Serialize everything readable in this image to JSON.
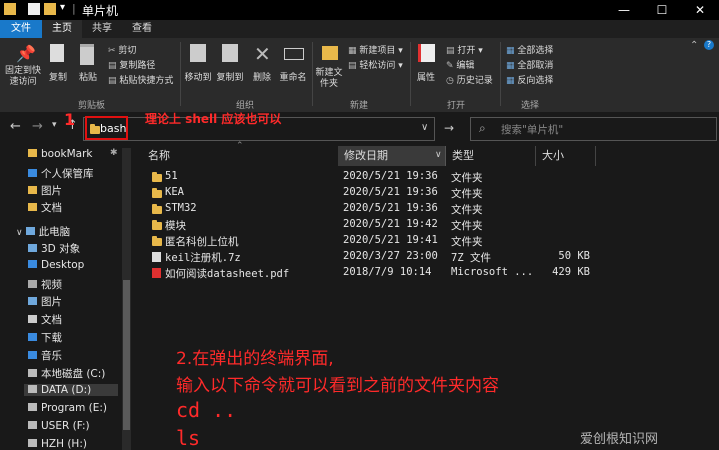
{
  "window": {
    "title": "单片机",
    "min": "—",
    "max": "☐",
    "close": "✕"
  },
  "tabs": [
    "文件",
    "主页",
    "共享",
    "查看"
  ],
  "ribbon": {
    "pin": "固定到快速访问",
    "copy": "复制",
    "paste": "粘贴",
    "cut": "剪切",
    "copy_path": "复制路径",
    "paste_shortcut": "粘贴快捷方式",
    "clipboard_group": "剪贴板",
    "move_to": "移动到",
    "copy_to": "复制到",
    "delete": "删除",
    "rename": "重命名",
    "organize_group": "组织",
    "new_folder": "新建文件夹",
    "new_item": "新建项目",
    "easy_access": "轻松访问",
    "new_group": "新建",
    "properties": "属性",
    "open": "打开",
    "edit": "编辑",
    "history": "历史记录",
    "open_group": "打开",
    "select_all": "全部选择",
    "select_none": "全部取消",
    "invert": "反向选择",
    "select_group": "选择"
  },
  "nav": {
    "address": "bash",
    "search_placeholder": "搜索\"单片机\"",
    "anno_num1": "1",
    "anno_text1": "理论上 shell 应该也可以"
  },
  "sidebar": [
    {
      "label": "bookMark",
      "icon": "folder-icon"
    },
    {
      "label": "个人保管库",
      "icon": "vault-icon"
    },
    {
      "label": "图片",
      "icon": "folder-icon"
    },
    {
      "label": "文档",
      "icon": "folder-icon"
    },
    {
      "label": "此电脑",
      "icon": "pc-icon"
    },
    {
      "label": "3D 对象",
      "icon": "cube-icon"
    },
    {
      "label": "Desktop",
      "icon": "desktop-icon"
    },
    {
      "label": "视频",
      "icon": "video-icon"
    },
    {
      "label": "图片",
      "icon": "picture-icon"
    },
    {
      "label": "文档",
      "icon": "document-icon"
    },
    {
      "label": "下载",
      "icon": "download-icon"
    },
    {
      "label": "音乐",
      "icon": "music-icon"
    },
    {
      "label": "本地磁盘 (C:)",
      "icon": "drive-icon"
    },
    {
      "label": "DATA (D:)",
      "icon": "drive-icon"
    },
    {
      "label": "Program (E:)",
      "icon": "drive-icon"
    },
    {
      "label": "USER (F:)",
      "icon": "drive-icon"
    },
    {
      "label": "HZH (H:)",
      "icon": "drive-icon"
    }
  ],
  "columns": {
    "name": "名称",
    "date": "修改日期",
    "type": "类型",
    "size": "大小"
  },
  "files": [
    {
      "name": "51",
      "date": "2020/5/21 19:36",
      "type": "文件夹",
      "size": "",
      "kind": "folder"
    },
    {
      "name": "KEA",
      "date": "2020/5/21 19:36",
      "type": "文件夹",
      "size": "",
      "kind": "folder"
    },
    {
      "name": "STM32",
      "date": "2020/5/21 19:36",
      "type": "文件夹",
      "size": "",
      "kind": "folder"
    },
    {
      "name": "模块",
      "date": "2020/5/21 19:42",
      "type": "文件夹",
      "size": "",
      "kind": "folder"
    },
    {
      "name": "匿名科创上位机",
      "date": "2020/5/21 19:41",
      "type": "文件夹",
      "size": "",
      "kind": "folder"
    },
    {
      "name": "keil注册机.7z",
      "date": "2020/3/27 23:00",
      "type": "7Z 文件",
      "size": "50 KB",
      "kind": "archive"
    },
    {
      "name": "如何阅读datasheet.pdf",
      "date": "2018/7/9 10:14",
      "type": "Microsoft ...",
      "size": "429 KB",
      "kind": "pdf"
    }
  ],
  "annotation": {
    "line1": "2.在弹出的终端界面,",
    "line2": "输入以下命令就可以看到之前的文件夹内容",
    "cmd1": "cd ..",
    "cmd2": "ls"
  },
  "watermark": "爱创根知识网"
}
